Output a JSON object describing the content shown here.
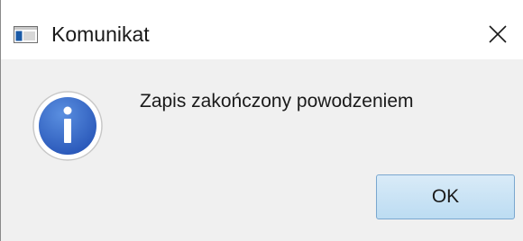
{
  "window": {
    "title": "Komunikat",
    "app_icon": "window-app-icon",
    "close_icon": "close-icon"
  },
  "dialog": {
    "icon": "info-icon",
    "message": "Zapis zakończony powodzeniem",
    "ok_label": "OK",
    "accent_color": "#2f64c5"
  }
}
